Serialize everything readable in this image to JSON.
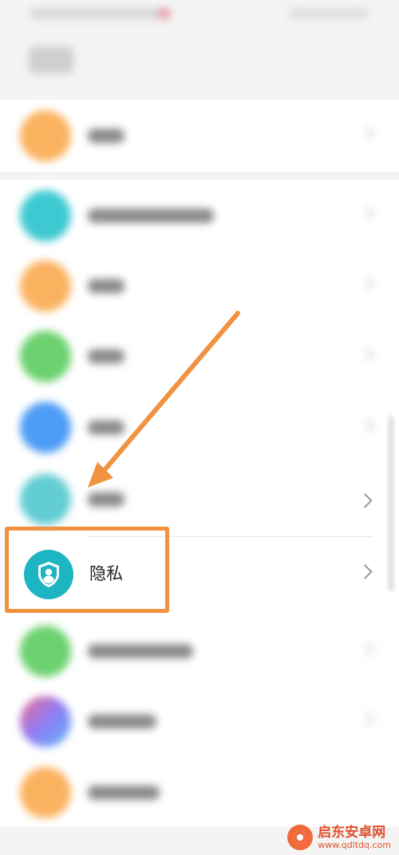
{
  "privacy_item": {
    "label": "隐私",
    "icon": "shield-person-icon"
  },
  "colors": {
    "highlight": "#f0923f",
    "privacy_icon_bg": "#1db5c2",
    "orange_icon": "#fbb25f",
    "cyan_icon": "#3ec9d2",
    "green_icon": "#6bd16e",
    "blue_icon": "#4d9cf5",
    "teal_icon": "#62cdd3"
  },
  "watermark": {
    "title": "启东安卓网",
    "url": "www.qdltdq.com",
    "icon": "watermark-logo-icon"
  }
}
